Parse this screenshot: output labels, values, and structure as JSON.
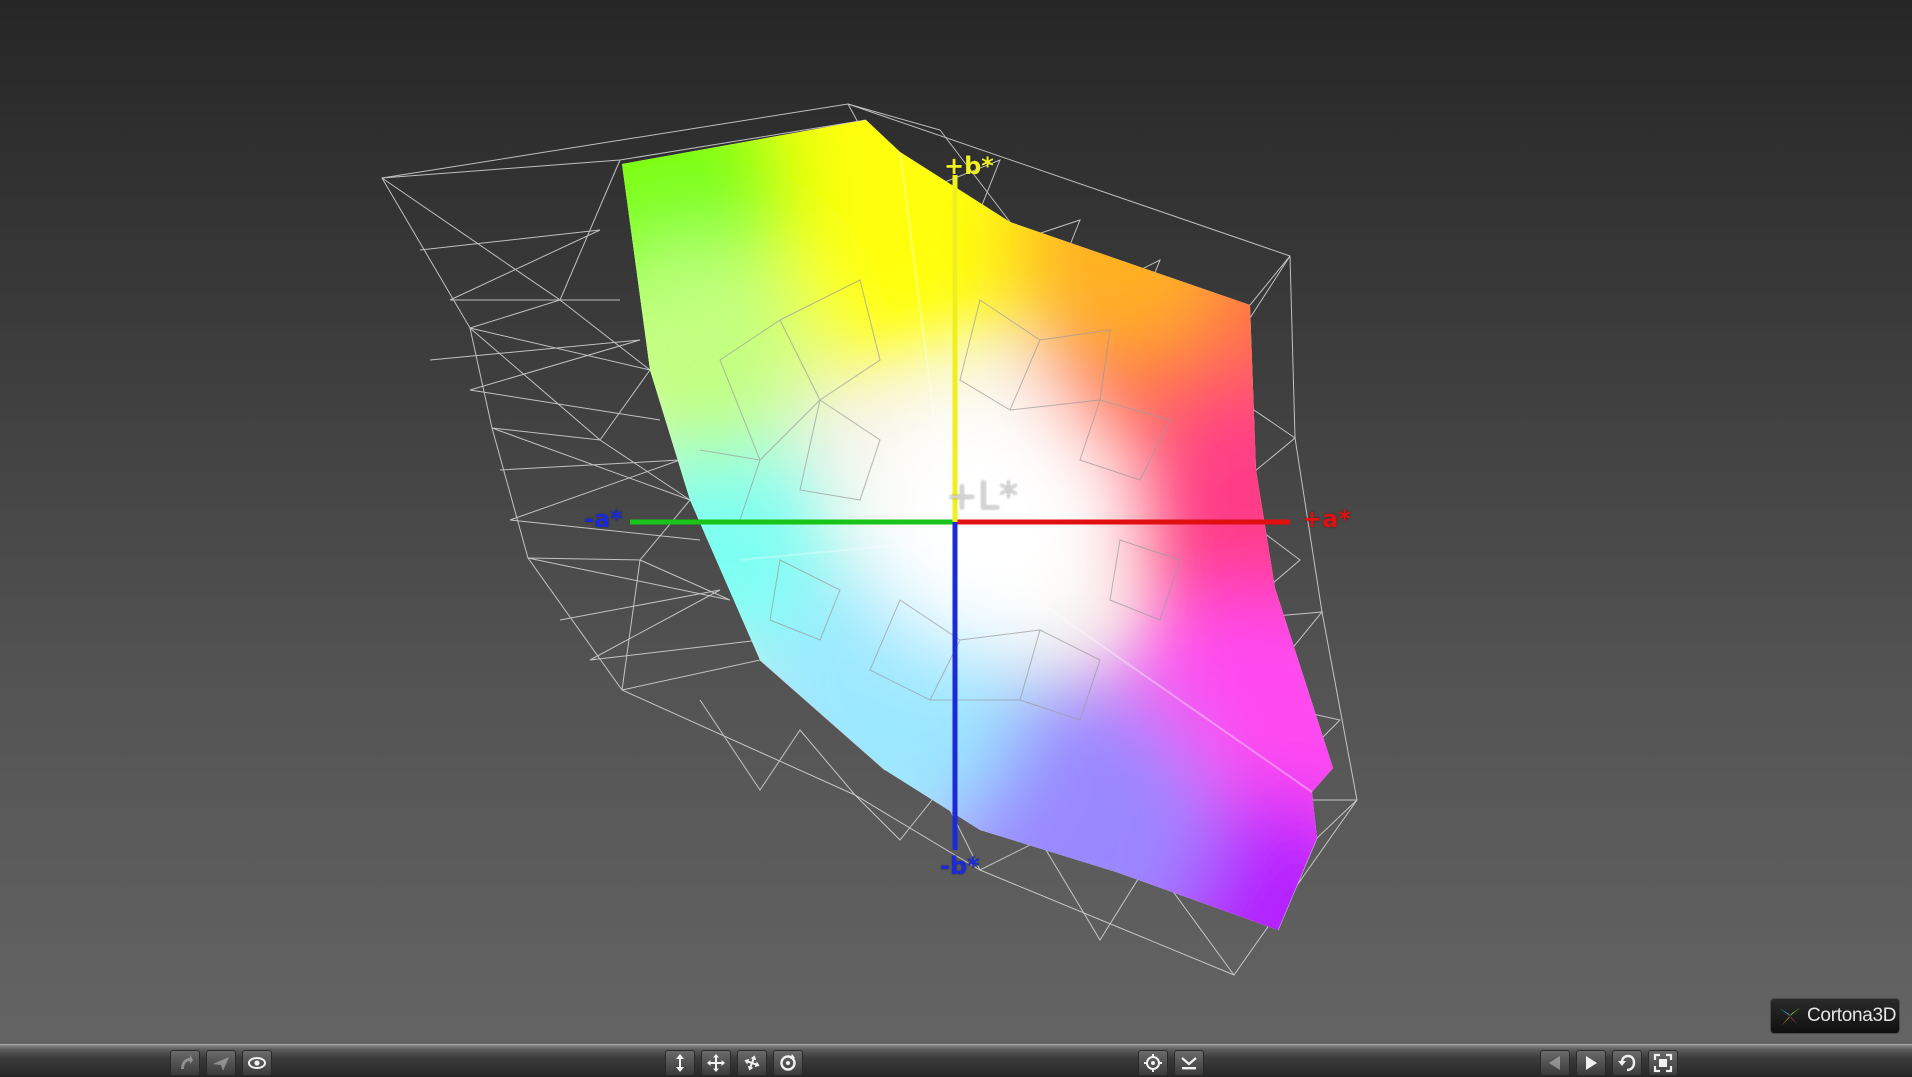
{
  "viewer": {
    "axes": {
      "l_plus": "+L*",
      "b_plus": "+b*",
      "a_plus": "+a*",
      "a_minus": "-a*",
      "b_minus": "-b*"
    },
    "axis_colors": {
      "l": "#dcdcdc",
      "b_plus": "#f0f020",
      "a_plus": "#e01010",
      "a_minus": "#19c419",
      "b_minus": "#1a2ad8"
    },
    "background_colors": [
      "#262626",
      "#646464"
    ]
  },
  "toolbar": {
    "left_group": [
      {
        "name": "walk-icon",
        "disabled": true
      },
      {
        "name": "fly-icon",
        "disabled": true
      },
      {
        "name": "study-eye-icon",
        "disabled": false
      }
    ],
    "center_group": [
      {
        "name": "slide-vertical-icon"
      },
      {
        "name": "pan-icon"
      },
      {
        "name": "turn-icon"
      },
      {
        "name": "rotate-icon"
      }
    ],
    "view_group": [
      {
        "name": "target-icon"
      },
      {
        "name": "align-icon"
      }
    ],
    "right_group": [
      {
        "name": "previous-viewpoint-icon",
        "disabled": true
      },
      {
        "name": "next-viewpoint-icon"
      },
      {
        "name": "restore-view-icon"
      },
      {
        "name": "fit-view-icon"
      }
    ]
  },
  "brand": {
    "name": "Cortona3D",
    "accent_color": "#2ea8e0"
  }
}
